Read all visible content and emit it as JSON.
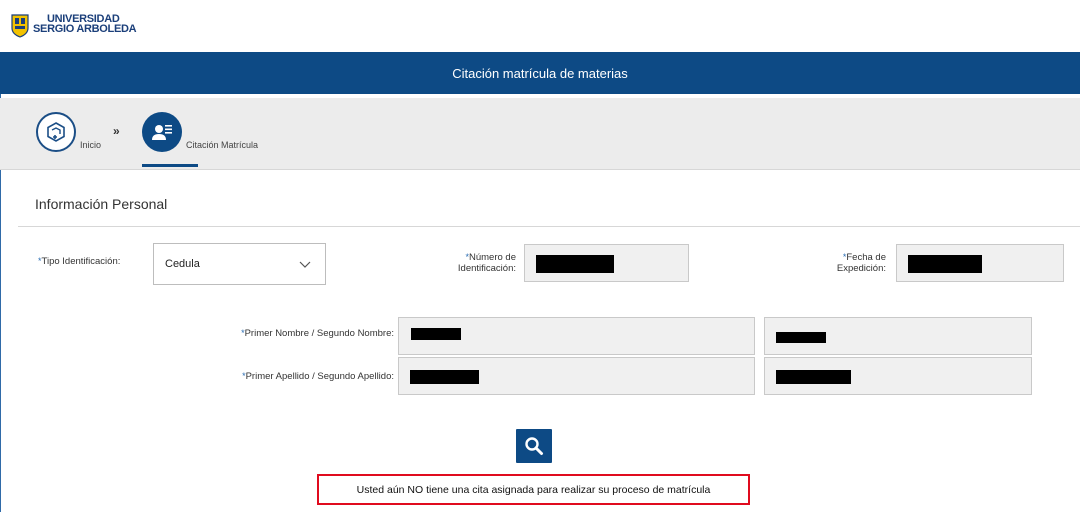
{
  "brand": {
    "line1": "UNIVERSIDAD",
    "line2": "SERGIO ARBOLEDA"
  },
  "page_title": "Citación matrícula de materias",
  "breadcrumb": {
    "home_label": "Inicio",
    "separator": "»",
    "current_label": "Citación Matrícula"
  },
  "section_title": "Información Personal",
  "required_mark": "*",
  "fields": {
    "tipo_identificacion": {
      "label": "Tipo Identificación:",
      "value": "Cedula"
    },
    "numero_identificacion": {
      "label_l1": "Número de",
      "label_l2": "Identificación:"
    },
    "fecha_expedicion": {
      "label_l1": "Fecha de",
      "label_l2": "Expedición:"
    },
    "nombres": {
      "label": "Primer Nombre / Segundo Nombre:"
    },
    "apellidos": {
      "label": "Primer Apellido / Segundo Apellido:"
    }
  },
  "alert_message": "Usted aún NO tiene una cita asignada para realizar su proceso de matrícula",
  "colors": {
    "primary": "#0d4a85",
    "alert_border": "#e00b1e",
    "required": "#2a6db3"
  },
  "icons": {
    "home": "home-plus-icon",
    "citation": "user-list-icon",
    "search": "search-icon",
    "dropdown": "chevron-down-icon"
  }
}
